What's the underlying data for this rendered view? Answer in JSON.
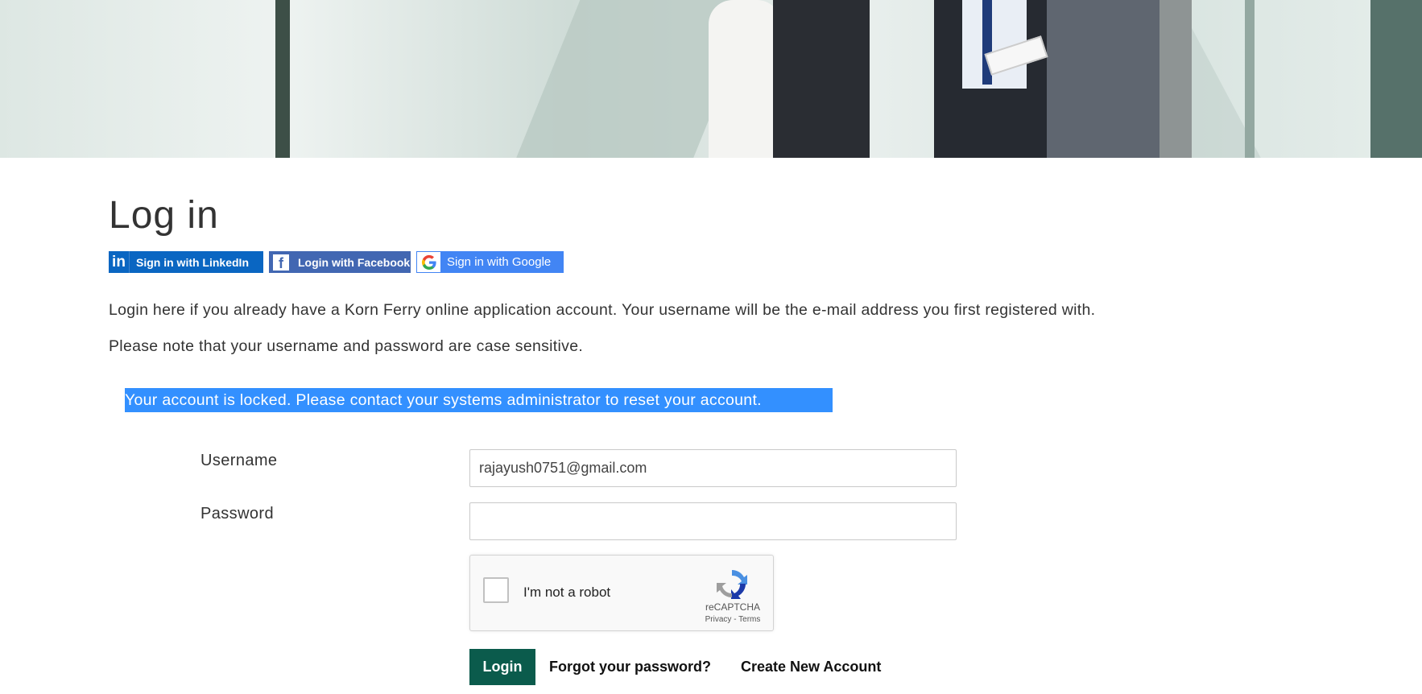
{
  "page": {
    "title": "Log in"
  },
  "social": {
    "linkedin_label": "Sign in with LinkedIn",
    "linkedin_icon_text": "in",
    "facebook_label": "Login with Facebook",
    "facebook_icon_text": "f",
    "google_label": "Sign in with Google"
  },
  "intro": {
    "line1": "Login here if you already have a Korn Ferry online application account. Your username will be the e-mail address you first registered with.",
    "line2": "Please note that your username and password are case sensitive."
  },
  "alert": {
    "message": "Your account is locked. Please contact your systems administrator to reset your account."
  },
  "form": {
    "username_label": "Username",
    "username_value": "rajayush0751@gmail.com",
    "password_label": "Password",
    "password_value": ""
  },
  "recaptcha": {
    "label": "I'm not a robot",
    "brand": "reCAPTCHA",
    "terms": "Privacy - Terms",
    "checked": false
  },
  "actions": {
    "login_label": "Login",
    "forgot_label": "Forgot your password?",
    "create_label": "Create New Account"
  },
  "colors": {
    "linkedin": "#0a66c2",
    "facebook": "#4267b2",
    "google": "#4285f4",
    "alert_bg": "#3390ff",
    "login_button": "#0b5b4c"
  }
}
